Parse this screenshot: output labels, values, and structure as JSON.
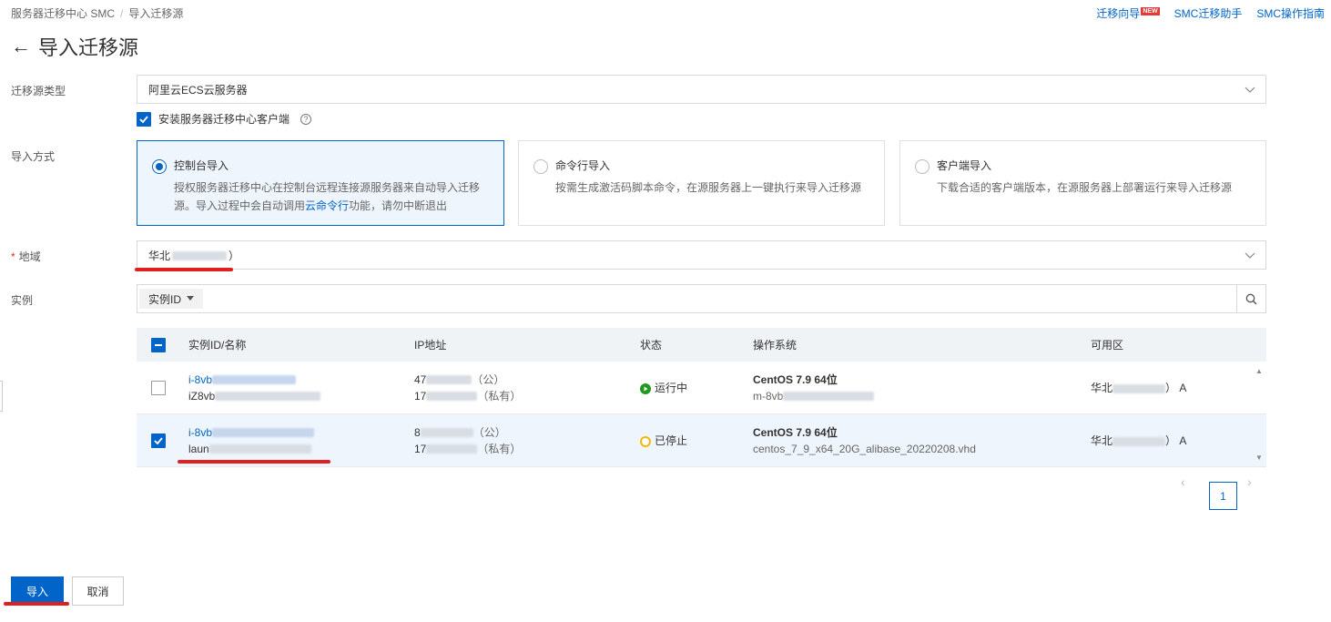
{
  "breadcrumb": {
    "root": "服务器迁移中心 SMC",
    "separator": "/",
    "current": "导入迁移源"
  },
  "toplinks": {
    "wizard": "迁移向导",
    "new_badge": "NEW",
    "assistant": "SMC迁移助手",
    "guide": "SMC操作指南"
  },
  "page": {
    "back_icon": "←",
    "title": "导入迁移源"
  },
  "form": {
    "source_type_label": "迁移源类型",
    "source_type_value": "阿里云ECS云服务器",
    "install_client_label": "安装服务器迁移中心客户端",
    "install_client_checked": true,
    "import_method_label": "导入方式",
    "methods": [
      {
        "title": "控制台导入",
        "desc_1": "授权服务器迁移中心在控制台远程连接源服务器来自动导入迁移",
        "desc_2_pre": "源。导入过程中会自动调用",
        "desc_2_link": "云命令行",
        "desc_2_post": "功能，请勿中断退出",
        "selected": true
      },
      {
        "title": "命令行导入",
        "desc": "按需生成激活码脚本命令，在源服务器上一键执行来导入迁移源",
        "selected": false
      },
      {
        "title": "客户端导入",
        "desc": "下载合适的客户端版本，在源服务器上部署运行来导入迁移源",
        "selected": false
      }
    ],
    "region_required_mark": "*",
    "region_label": "地域",
    "region_value_prefix": "华北",
    "region_value_suffix": "）",
    "instance_label": "实例",
    "search_field": "实例ID"
  },
  "table": {
    "headers": {
      "id": "实例ID/名称",
      "ip": "IP地址",
      "status": "状态",
      "os": "操作系统",
      "zone": "可用区"
    },
    "rows": [
      {
        "id_prefix": "i-8vb",
        "name_prefix": "iZ8vb",
        "ip_pub_prefix": "47",
        "ip_pub_tag": "（公）",
        "ip_priv_prefix": "17",
        "ip_priv_tag": "（私有）",
        "status": "运行中",
        "status_color": "#1e9a1e",
        "os": "CentOS 7.9 64位",
        "image_prefix": "m-8vb",
        "zone_prefix": "华北",
        "zone_suffix": "） A",
        "checked": false
      },
      {
        "id_prefix": "i-8vb",
        "name_prefix": "laun",
        "ip_pub_prefix": "8",
        "ip_pub_tag": "（公）",
        "ip_priv_prefix": "17",
        "ip_priv_tag": "（私有）",
        "status": "已停止",
        "status_color": "#f5b800",
        "os": "CentOS 7.9 64位",
        "image": "centos_7_9_x64_20G_alibase_20220208.vhd",
        "zone_prefix": "华北",
        "zone_suffix": "） A",
        "checked": true
      }
    ]
  },
  "pagination": {
    "current_page": "1",
    "prev": "‹",
    "next": "›"
  },
  "actions": {
    "import": "导入",
    "cancel": "取消"
  },
  "colors": {
    "primary": "#0064c8",
    "annotation": "#e02020"
  }
}
